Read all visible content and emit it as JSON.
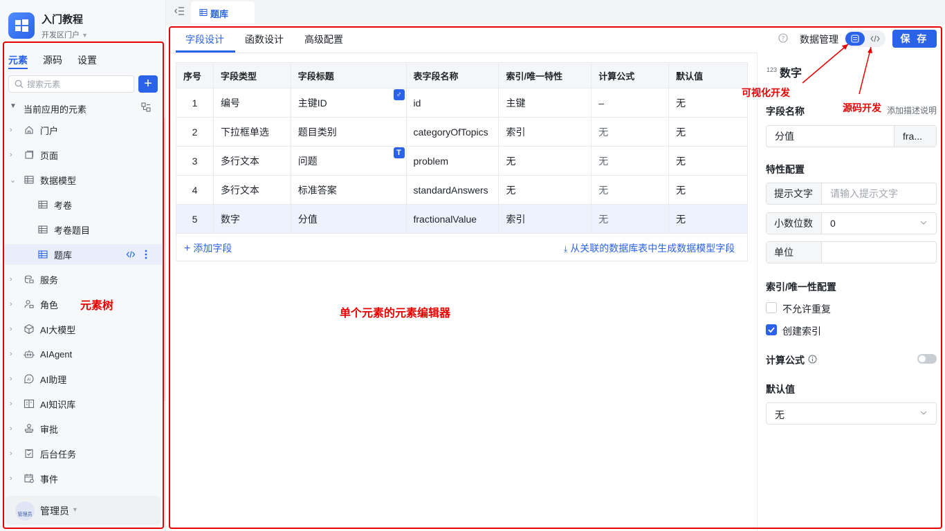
{
  "app": {
    "title": "入门教程",
    "portal": "开发区门户"
  },
  "sidebar": {
    "tabs": [
      {
        "label": "元素"
      },
      {
        "label": "源码"
      },
      {
        "label": "设置"
      }
    ],
    "search": {
      "placeholder": "搜索元素",
      "value": ""
    },
    "add_label": "+",
    "root_label": "当前应用的元素",
    "items": [
      {
        "label": "门户",
        "icon": "home-icon"
      },
      {
        "label": "页面",
        "icon": "page-icon"
      },
      {
        "label": "数据模型",
        "icon": "table-icon"
      },
      {
        "label": "考卷",
        "icon": "table-icon"
      },
      {
        "label": "考卷题目",
        "icon": "table-icon"
      },
      {
        "label": "题库",
        "icon": "table-icon"
      },
      {
        "label": "服务",
        "icon": "service-icon"
      },
      {
        "label": "角色",
        "icon": "role-icon"
      },
      {
        "label": "AI大模型",
        "icon": "model-icon"
      },
      {
        "label": "AIAgent",
        "icon": "robot-icon"
      },
      {
        "label": "AI助理",
        "icon": "assistant-icon"
      },
      {
        "label": "AI知识库",
        "icon": "book-icon"
      },
      {
        "label": "审批",
        "icon": "stamp-icon"
      },
      {
        "label": "后台任务",
        "icon": "task-icon"
      },
      {
        "label": "事件",
        "icon": "event-icon"
      }
    ],
    "user": {
      "name": "管理员",
      "avatar_text": "管理员"
    }
  },
  "topbar": {
    "tab_label": "题库"
  },
  "editor": {
    "tabs": [
      {
        "label": "字段设计"
      },
      {
        "label": "函数设计"
      },
      {
        "label": "高级配置"
      }
    ],
    "data_mgmt_label": "数据管理",
    "save_label": "保 存",
    "table": {
      "headers": [
        "序号",
        "字段类型",
        "字段标题",
        "表字段名称",
        "索引/唯一特性",
        "计算公式",
        "默认值"
      ],
      "rows": [
        [
          "1",
          "编号",
          "主键ID",
          "id",
          "主键",
          "–",
          "无"
        ],
        [
          "2",
          "下拉框单选",
          "题目类别",
          "categoryOfTopics",
          "索引",
          "无",
          "无"
        ],
        [
          "3",
          "多行文本",
          "问题",
          "problem",
          "无",
          "无",
          "无"
        ],
        [
          "4",
          "多行文本",
          "标准答案",
          "standardAnswers",
          "无",
          "无",
          "无"
        ],
        [
          "5",
          "数字",
          "分值",
          "fractionalValue",
          "索引",
          "无",
          "无"
        ]
      ],
      "badges": {
        "row1": "♂",
        "row3": "T"
      }
    },
    "add_field_label": "添加字段",
    "gen_fields_label": "从关联的数据库表中生成数据模型字段"
  },
  "props": {
    "type_icon_text": "123",
    "type_title": "数字",
    "field_name_heading": "字段名称",
    "add_desc_label": "添加描述说明",
    "field_name_value": "分值",
    "field_code_value": "fra...",
    "feature_heading": "特性配置",
    "hint_label": "提示文字",
    "hint_placeholder": "请输入提示文字",
    "decimal_label": "小数位数",
    "decimal_value": "0",
    "unit_label": "单位",
    "unit_value": "",
    "index_heading": "索引/唯一性配置",
    "no_dup_label": "不允许重复",
    "create_index_label": "创建索引",
    "formula_heading": "计算公式",
    "default_heading": "默认值",
    "default_value": "无"
  },
  "annotations": {
    "tree_label": "元素树",
    "editor_label": "单个元素的元素编辑器",
    "visual_label": "可视化开发",
    "code_label": "源码开发",
    "color": "#e60000"
  },
  "colors": {
    "accent": "#2b63e8"
  }
}
